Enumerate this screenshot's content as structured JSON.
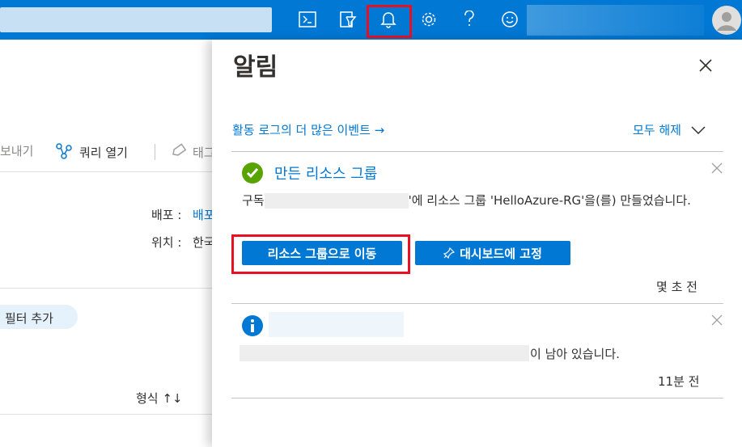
{
  "topbar": {
    "icons": [
      "cloud-shell-icon",
      "directory-filter-icon",
      "bell-icon",
      "gear-icon",
      "help-icon",
      "feedback-icon"
    ]
  },
  "background": {
    "toolbar": {
      "export_label": "보내기",
      "query_label": "쿼리 열기",
      "tag_label": "태그"
    },
    "details": {
      "deploy_key": "배포 :",
      "deploy_value": "배포",
      "location_key": "위치 :",
      "location_value": "한국"
    },
    "filter_label": "필터 추가",
    "sort_header": "형식 ↑↓"
  },
  "panel": {
    "title": "알림",
    "activity_link": "활동 로그의 더 많은 이벤트 →",
    "dismiss_all": "모두 해제",
    "notifications": [
      {
        "title": "만든 리소스 그룹",
        "body_prefix": "구독",
        "body_suffix": "'에 리소스 그룹 'HelloAzure-RG'을(를) 만들었습니다.",
        "primary_button": "리소스 그룹으로 이동",
        "secondary_button": "대시보드에 고정",
        "time": "몇 초 전"
      },
      {
        "body_suffix": "이 남아 있습니다.",
        "time": "11분 전"
      }
    ]
  },
  "colors": {
    "accent": "#0078d4",
    "highlight": "#e81123",
    "success": "#57a300"
  }
}
